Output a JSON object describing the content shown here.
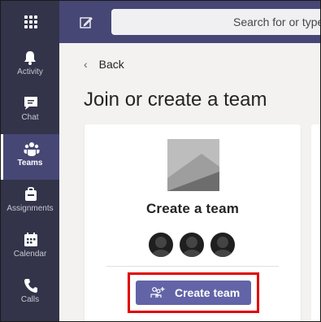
{
  "search": {
    "placeholder": "Search for or type"
  },
  "rail": [
    {
      "label": "Activity",
      "icon": "bell-icon"
    },
    {
      "label": "Chat",
      "icon": "chat-icon"
    },
    {
      "label": "Teams",
      "icon": "teams-icon",
      "active": true
    },
    {
      "label": "Assignments",
      "icon": "assignments-icon"
    },
    {
      "label": "Calendar",
      "icon": "calendar-icon"
    },
    {
      "label": "Calls",
      "icon": "phone-icon"
    }
  ],
  "main": {
    "back_label": "Back",
    "title": "Join or create a team",
    "card": {
      "title": "Create a team",
      "button_label": "Create team"
    }
  },
  "colors": {
    "topbar": "#464775",
    "rail": "#33344a",
    "accent": "#6264a7",
    "highlight": "#e10000"
  }
}
